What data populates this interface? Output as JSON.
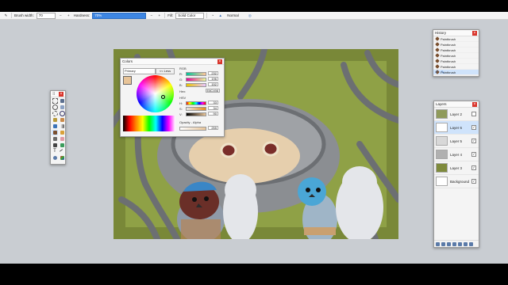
{
  "toolbar": {
    "brush_width_label": "Brush width:",
    "brush_width_value": "70",
    "hardness_label": "Hardness:",
    "hardness_value": "70%",
    "fill_label": "Fill:",
    "fill_value": "Solid Color",
    "blend_value": "Normal"
  },
  "colors": {
    "title": "Colors",
    "mode": "Primary",
    "less_button": "<< Less",
    "rgb_label": "RGB",
    "r_label": "R:",
    "r_value": "232",
    "g_label": "G:",
    "g_value": "196",
    "b_label": "B:",
    "b_value": "152",
    "hex_label": "Hex:",
    "hex_value": "E8C498",
    "hsv_label": "HSV",
    "h_label": "H:",
    "h_value": "33",
    "s_label": "S:",
    "s_value": "34",
    "v_label": "V:",
    "v_value": "90",
    "opacity_label": "Opacity - Alpha",
    "opacity_value": "255",
    "primary_color": "#e8c498"
  },
  "history": {
    "title": "History",
    "items": [
      "Paintbrush",
      "Paintbrush",
      "Paintbrush",
      "Paintbrush",
      "Paintbrush",
      "Paintbrush",
      "Paintbrush"
    ]
  },
  "layers": {
    "title": "Layers",
    "items": [
      {
        "name": "Layer 2",
        "checked": false
      },
      {
        "name": "Layer 6",
        "checked": true
      },
      {
        "name": "Layer 5",
        "checked": true
      },
      {
        "name": "Layer 4",
        "checked": true
      },
      {
        "name": "Layer 3",
        "checked": true
      },
      {
        "name": "Background",
        "checked": true
      }
    ]
  },
  "accent": "#3d86e3"
}
